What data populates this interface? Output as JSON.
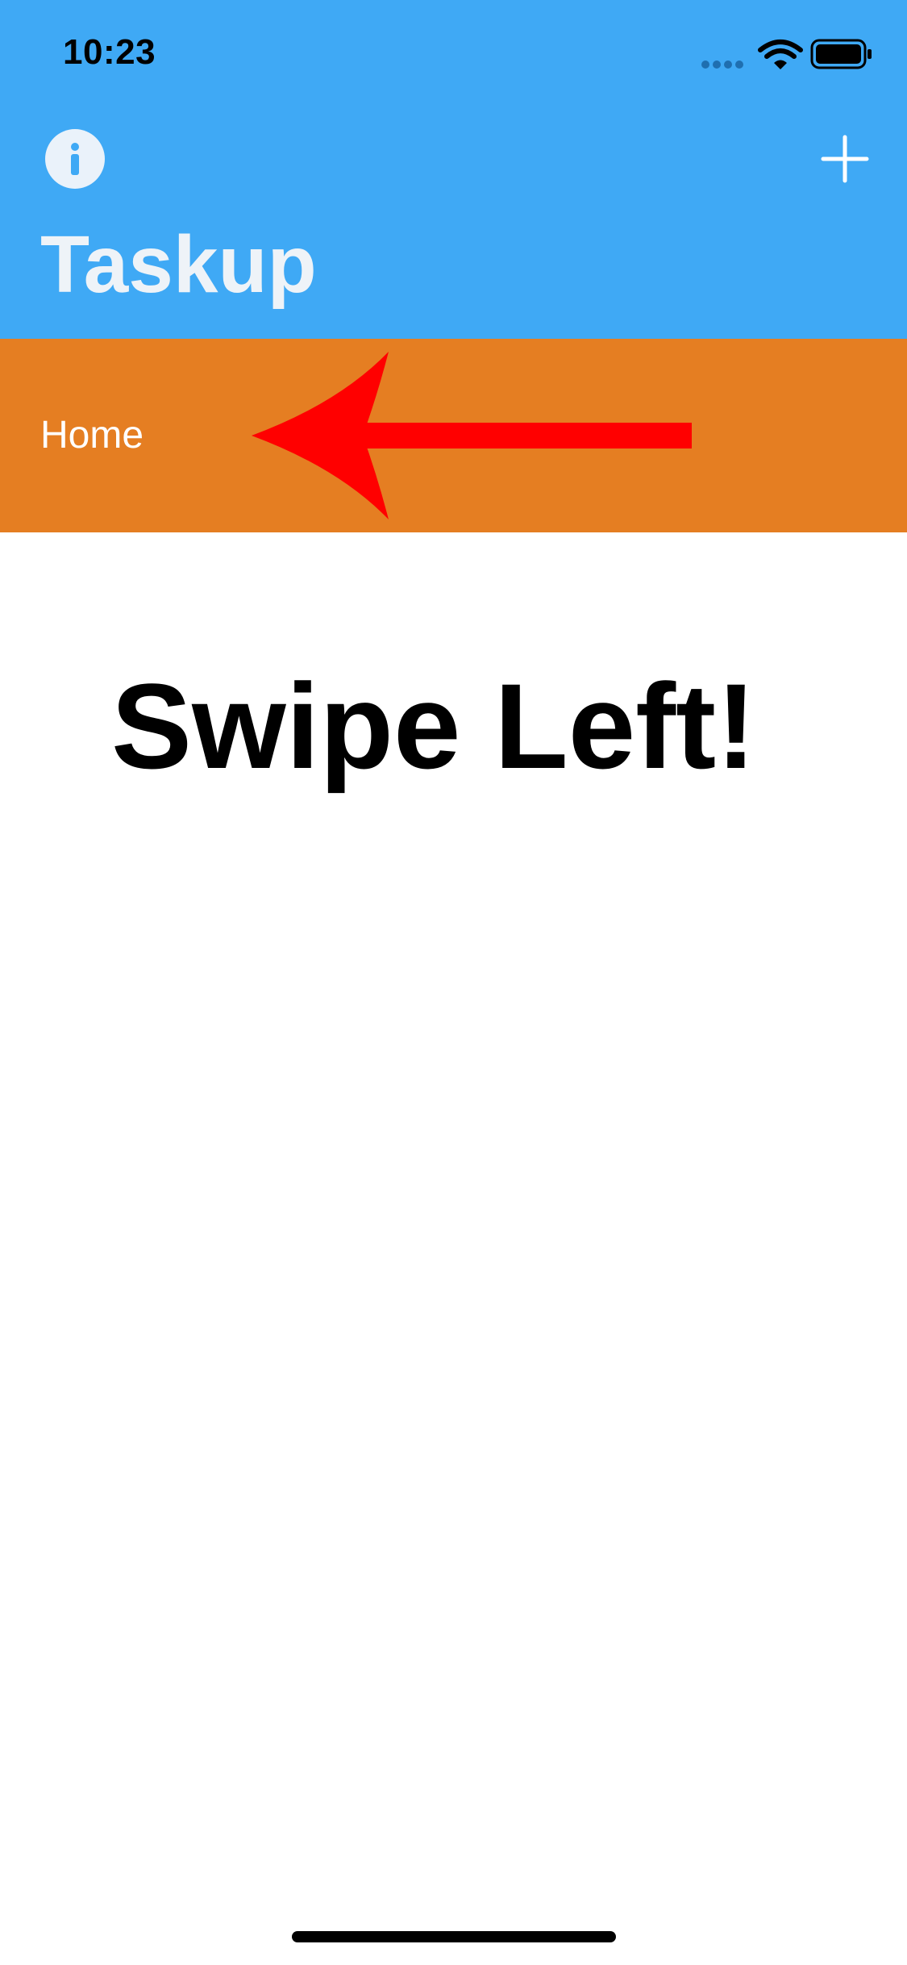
{
  "status_bar": {
    "time": "10:23",
    "icons": [
      "signal-icon",
      "wifi-icon",
      "battery-icon"
    ]
  },
  "nav_bar": {
    "title": "Taskup",
    "left_icon": "info-icon",
    "right_icon": "plus-icon",
    "background_color": "#3fa9f5"
  },
  "list": {
    "items": [
      {
        "label": "Home",
        "background_color": "#e57e22"
      }
    ]
  },
  "overlay": {
    "arrow_icon": "left-arrow-icon",
    "arrow_color": "#ff0000",
    "hint_text": "Swipe Left!"
  }
}
